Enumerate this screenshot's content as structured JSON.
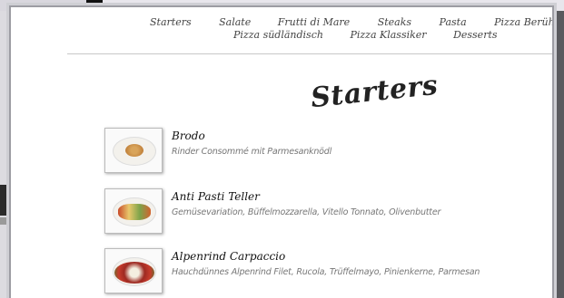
{
  "nav": {
    "row1": [
      "Starters",
      "Salate",
      "Frutti di Mare",
      "Steaks",
      "Pasta",
      "Pizza Berühmtheiten"
    ],
    "row2": [
      "Pizza südländisch",
      "Pizza Klassiker",
      "Desserts"
    ]
  },
  "section": {
    "title": "Starters"
  },
  "items": [
    {
      "name": "Brodo",
      "description": "Rinder Consommé mit Parmesanknödl",
      "image_icon": "soup-plate-photo"
    },
    {
      "name": "Anti Pasti Teller",
      "description": "Gemüsevariation, Büffelmozzarella, Vitello Tonnato, Olivenbutter",
      "image_icon": "antipasti-plate-photo"
    },
    {
      "name": "Alpenrind Carpaccio",
      "description": "Hauchdünnes Alpenrind Filet, Rucola, Trüffelmayo, Pinienkerne, Parmesan",
      "image_icon": "carpaccio-plate-photo"
    }
  ]
}
